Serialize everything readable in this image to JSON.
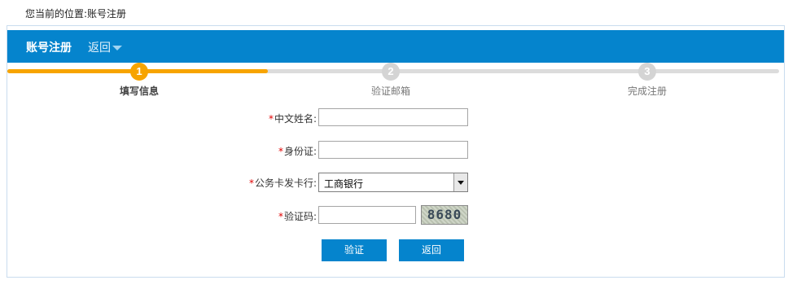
{
  "breadcrumb": {
    "text": "您当前的位置:账号注册"
  },
  "header": {
    "title": "账号注册",
    "back_label": "返回"
  },
  "steps": [
    {
      "number": "1",
      "label": "填写信息",
      "active": true
    },
    {
      "number": "2",
      "label": "验证邮箱",
      "active": false
    },
    {
      "number": "3",
      "label": "完成注册",
      "active": false
    }
  ],
  "progress": {
    "completed_fraction": 0.33
  },
  "form": {
    "required_mark": "*",
    "name_label": "中文姓名:",
    "name_value": "",
    "id_label": "身份证:",
    "id_value": "",
    "bank_label": "公务卡发卡行:",
    "bank_selected": "工商银行",
    "captcha_label": "验证码:",
    "captcha_value": "",
    "captcha_image_text": "8680"
  },
  "buttons": {
    "verify_label": "验证",
    "back_label": "返回"
  },
  "colors": {
    "accent": "#0584cd",
    "progress": "#f7a400",
    "required": "#e00000"
  }
}
